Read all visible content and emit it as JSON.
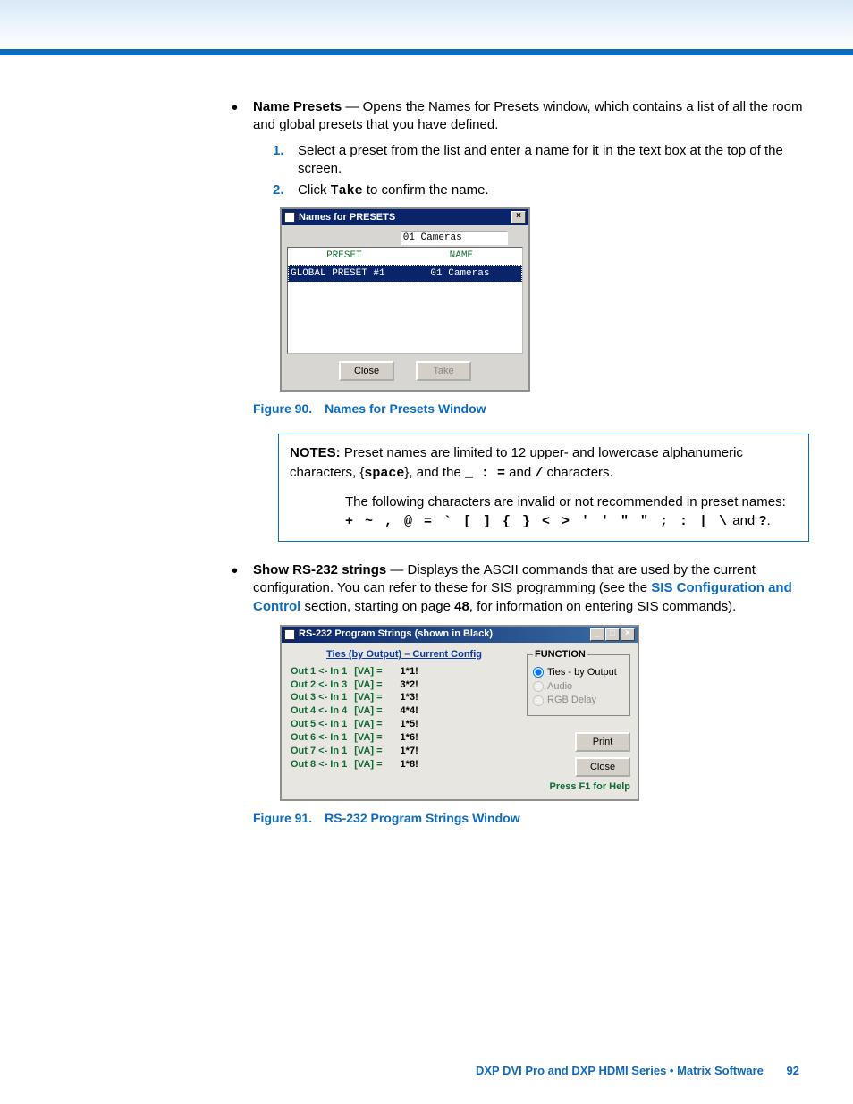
{
  "bullets": {
    "namePresets": {
      "label": "Name Presets",
      "desc": " — Opens the Names for Presets window, which contains a list of all the room and global presets that you have defined.",
      "steps": [
        "Select a preset from the list and enter a name for it in the text box at the top of the screen.",
        "Click "
      ],
      "takeWord": "Take",
      "step2suffix": " to confirm the name."
    },
    "showRS232": {
      "label": "Show RS-232 strings",
      "descA": " — Displays the ASCII commands that are used by the current configuration. You can refer to these for SIS programming (see the ",
      "link": "SIS Configuration and Control",
      "descB": " section, starting on page ",
      "pageRef": "48",
      "descC": ", for information on entering SIS commands)."
    }
  },
  "figure90": {
    "caption_num": "Figure 90.",
    "caption_text": "Names for Presets Window",
    "title": "Names for PRESETS",
    "input_value": "01 Cameras",
    "colA": "PRESET",
    "colB": "NAME",
    "row_preset": "GLOBAL PRESET #1",
    "row_name": "01 Cameras",
    "btn_close": "Close",
    "btn_take": "Take"
  },
  "notes": {
    "label": "NOTES:",
    "p1a": "Preset names are limited to 12 upper- and lowercase alphanumeric characters, {",
    "p1_space": "space",
    "p1b": "}, and the ",
    "p1_chars": "_ : =",
    "p1c": " and ",
    "p1_slash": "/",
    "p1d": " characters.",
    "p2a": "The following characters are invalid or not recommended in preset names:",
    "p2chars": "+  ~  ,  @  =  `  [  ]  {  }  <  >  '  '  \"  \"  ;  :  |  \\",
    "p2b": " and ",
    "p2q": "?",
    "p2c": "."
  },
  "figure91": {
    "caption_num": "Figure 91.",
    "caption_text": "RS-232 Program Strings Window",
    "title": "RS-232 Program Strings (shown in Black)",
    "heading": "Ties (by Output) – Current Config",
    "ties": [
      {
        "out": "Out 1 <- In 1",
        "va": "[VA] =",
        "val": "1*1!"
      },
      {
        "out": "Out 2 <- In 3",
        "va": "[VA] =",
        "val": "3*2!"
      },
      {
        "out": "Out 3 <- In 1",
        "va": "[VA] =",
        "val": "1*3!"
      },
      {
        "out": "Out 4 <- In 4",
        "va": "[VA] =",
        "val": "4*4!"
      },
      {
        "out": "Out 5 <- In 1",
        "va": "[VA] =",
        "val": "1*5!"
      },
      {
        "out": "Out 6 <- In 1",
        "va": "[VA] =",
        "val": "1*6!"
      },
      {
        "out": "Out 7 <- In 1",
        "va": "[VA] =",
        "val": "1*7!"
      },
      {
        "out": "Out 8 <- In 1",
        "va": "[VA] =",
        "val": "1*8!"
      }
    ],
    "legend": "FUNCTION",
    "opt1": "Ties - by Output",
    "opt2": "Audio",
    "opt3": "RGB Delay",
    "btn_print": "Print",
    "btn_close": "Close",
    "help": "Press F1 for Help"
  },
  "footer": {
    "text": "DXP DVI Pro and DXP HDMI Series • Matrix Software",
    "page": "92"
  }
}
